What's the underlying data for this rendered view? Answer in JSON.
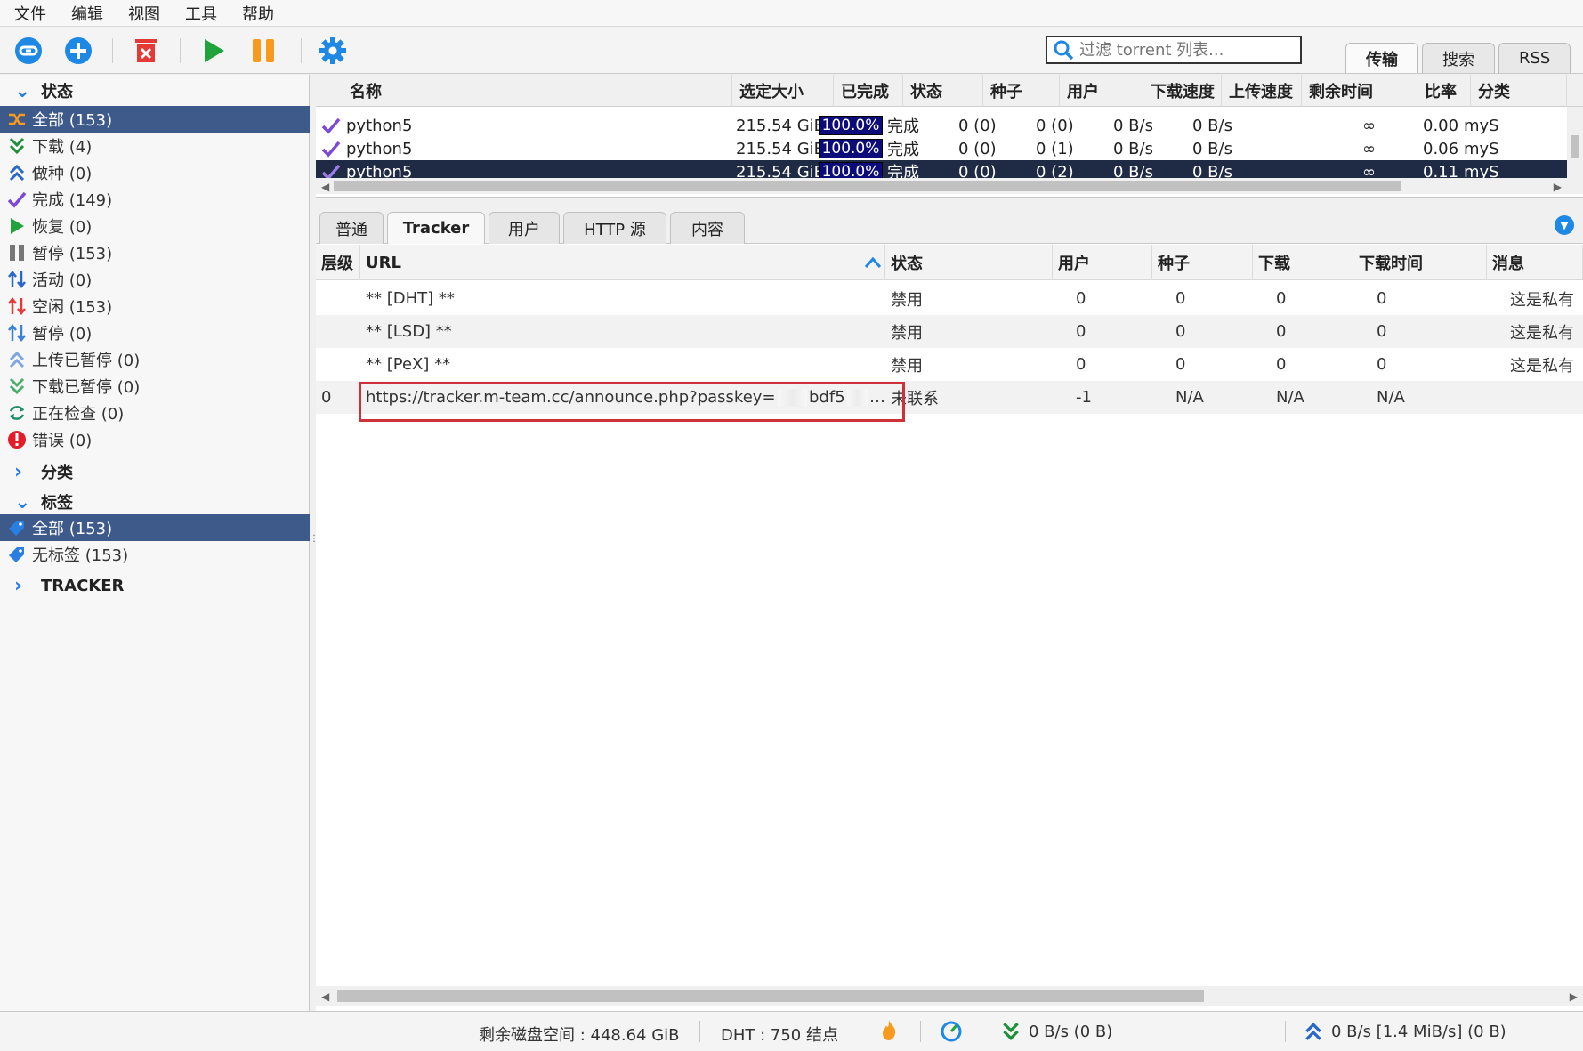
{
  "menu": [
    "文件",
    "编辑",
    "视图",
    "工具",
    "帮助"
  ],
  "search": {
    "placeholder": "过滤 torrent 列表..."
  },
  "top_tabs": [
    "传输",
    "搜索",
    "RSS"
  ],
  "sidebar": {
    "status_header": "状态",
    "status_items": [
      {
        "label": "全部 (153)",
        "icon": "all-icon"
      },
      {
        "label": "下载 (4)",
        "icon": "download-icon"
      },
      {
        "label": "做种 (0)",
        "icon": "seeding-icon"
      },
      {
        "label": "完成 (149)",
        "icon": "completed-icon"
      },
      {
        "label": "恢复 (0)",
        "icon": "resume-icon"
      },
      {
        "label": "暂停 (153)",
        "icon": "paused-icon"
      },
      {
        "label": "活动 (0)",
        "icon": "active-icon"
      },
      {
        "label": "空闲 (153)",
        "icon": "inactive-icon"
      },
      {
        "label": "暂停 (0)",
        "icon": "stalled-icon"
      },
      {
        "label": "上传已暂停 (0)",
        "icon": "stalled-upload-icon"
      },
      {
        "label": "下载已暂停 (0)",
        "icon": "stalled-download-icon"
      },
      {
        "label": "正在检查 (0)",
        "icon": "checking-icon"
      },
      {
        "label": "错误 (0)",
        "icon": "error-icon"
      }
    ],
    "category_header": "分类",
    "tags_header": "标签",
    "tag_items": [
      {
        "label": "全部 (153)",
        "icon": "tag-icon"
      },
      {
        "label": "无标签 (153)",
        "icon": "tag-icon"
      }
    ],
    "tracker_header": "TRACKER"
  },
  "torrent_list": {
    "columns": [
      "名称",
      "选定大小",
      "已完成",
      "状态",
      "种子",
      "用户",
      "下载速度",
      "上传速度",
      "剩余时间",
      "比率",
      "分类"
    ],
    "rows": [
      {
        "name": "python5",
        "size": "215.54 GiB",
        "progress": "100.0%",
        "status": "完成",
        "seeds": "0 (0)",
        "peers": "0 (0)",
        "down": "0 B/s",
        "up": "0 B/s",
        "eta": "∞",
        "ratio": "0.00",
        "category": "myS"
      },
      {
        "name": "python5",
        "size": "215.54 GiB",
        "progress": "100.0%",
        "status": "完成",
        "seeds": "0 (0)",
        "peers": "0 (1)",
        "down": "0 B/s",
        "up": "0 B/s",
        "eta": "∞",
        "ratio": "0.06",
        "category": "myS"
      },
      {
        "name": "python5",
        "size": "215.54 GiB",
        "progress": "100.0%",
        "status": "完成",
        "seeds": "0 (0)",
        "peers": "0 (2)",
        "down": "0 B/s",
        "up": "0 B/s",
        "eta": "∞",
        "ratio": "0.11",
        "category": "myS"
      }
    ]
  },
  "detail_tabs": [
    "普通",
    "Tracker",
    "用户",
    "HTTP 源",
    "内容"
  ],
  "trackers": {
    "columns": [
      "层级",
      "URL",
      "状态",
      "用户",
      "种子",
      "下载",
      "下载时间",
      "消息"
    ],
    "rows": [
      {
        "tier": "",
        "url": "** [DHT] **",
        "status": "禁用",
        "peers": "0",
        "seeds": "0",
        "leeches": "0",
        "downloaded": "0",
        "message": "这是私有"
      },
      {
        "tier": "",
        "url": "** [LSD] **",
        "status": "禁用",
        "peers": "0",
        "seeds": "0",
        "leeches": "0",
        "downloaded": "0",
        "message": "这是私有"
      },
      {
        "tier": "",
        "url": "** [PeX] **",
        "status": "禁用",
        "peers": "0",
        "seeds": "0",
        "leeches": "0",
        "downloaded": "0",
        "message": "这是私有"
      },
      {
        "tier": "0",
        "url_prefix": "https://tracker.m-team.cc/announce.php?passkey=",
        "url_mid": "bdf5",
        "url_suffix": "…",
        "status": "未联系",
        "peers": "-1",
        "seeds": "N/A",
        "leeches": "N/A",
        "downloaded": "N/A",
        "message": ""
      }
    ]
  },
  "statusbar": {
    "disk": "剩余磁盘空间 : 448.64 GiB",
    "dht": "DHT : 750 结点",
    "download": "0 B/s (0 B)",
    "upload": "0 B/s [1.4 MiB/s] (0 B)"
  },
  "colors": {
    "selection": "#3e5a8a",
    "progress": "#0b0b7a",
    "highlight_border": "#d0303a",
    "accent": "#1e88e5"
  }
}
